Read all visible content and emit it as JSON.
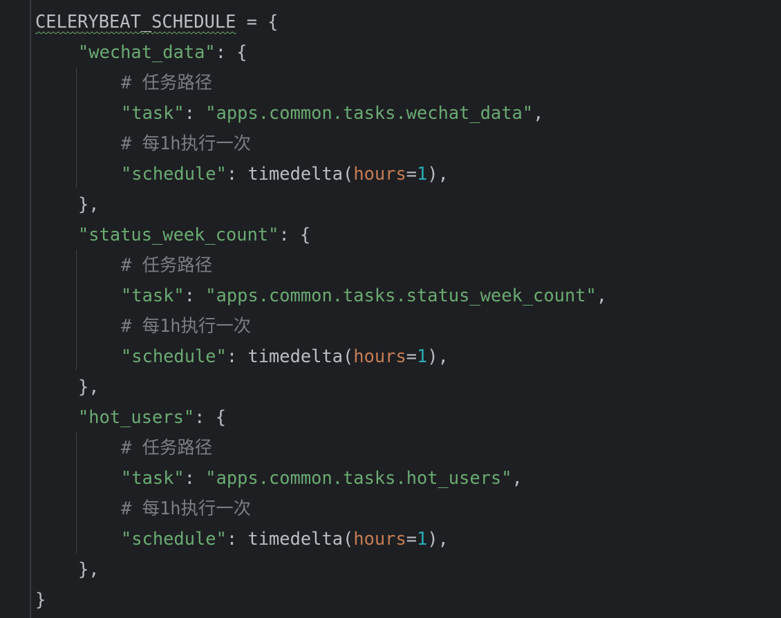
{
  "code": {
    "var_name": "CELERYBEAT_SCHEDULE",
    "assign": " = {",
    "entries": [
      {
        "key": "\"wechat_data\"",
        "key_suffix": ": {",
        "comment_task": "# 任务路径",
        "task_key": "\"task\"",
        "task_sep": ": ",
        "task_value": "\"apps.common.tasks.wechat_data\"",
        "task_suffix": ",",
        "comment_schedule": "# 每1h执行一次",
        "schedule_key": "\"schedule\"",
        "schedule_sep": ": timedelta(",
        "kwarg": "hours",
        "eq": "=",
        "num": "1",
        "schedule_suffix": "),",
        "close": "},"
      },
      {
        "key": "\"status_week_count\"",
        "key_suffix": ": {",
        "comment_task": "# 任务路径",
        "task_key": "\"task\"",
        "task_sep": ": ",
        "task_value": "\"apps.common.tasks.status_week_count\"",
        "task_suffix": ",",
        "comment_schedule": "# 每1h执行一次",
        "schedule_key": "\"schedule\"",
        "schedule_sep": ": timedelta(",
        "kwarg": "hours",
        "eq": "=",
        "num": "1",
        "schedule_suffix": "),",
        "close": "},"
      },
      {
        "key": "\"hot_users\"",
        "key_suffix": ": {",
        "comment_task": "# 任务路径",
        "task_key": "\"task\"",
        "task_sep": ": ",
        "task_value": "\"apps.common.tasks.hot_users\"",
        "task_suffix": ",",
        "comment_schedule": "# 每1h执行一次",
        "schedule_key": "\"schedule\"",
        "schedule_sep": ": timedelta(",
        "kwarg": "hours",
        "eq": "=",
        "num": "1",
        "schedule_suffix": "),",
        "close": "},"
      }
    ],
    "final_close": "}"
  },
  "colors": {
    "background": "#1e1f22",
    "default_text": "#bcbec4",
    "string": "#6aab73",
    "comment": "#7a7e85",
    "keyword_arg": "#c77d55",
    "number": "#2aacb8"
  }
}
